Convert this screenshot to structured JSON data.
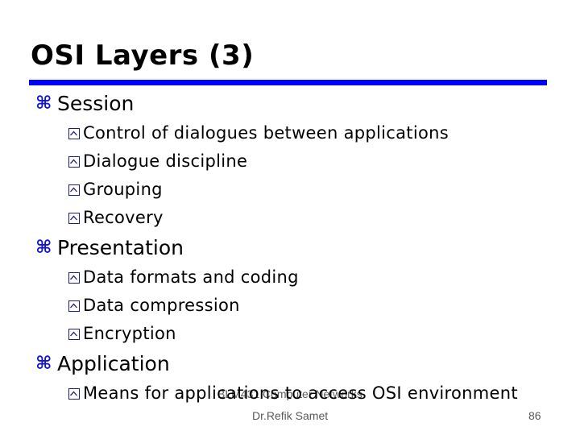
{
  "slide": {
    "title": "OSI Layers (3)",
    "accent_color": "#0000ff",
    "bullet_icon_l1": "command-key-icon",
    "bullet_icon_l2": "boxed-chevron-icon",
    "bullet_l1_glyph": "⌘",
    "sections": [
      {
        "heading": "Session",
        "items": [
          "Control of dialogues between applications",
          "Dialogue discipline",
          "Grouping",
          "Recovery"
        ]
      },
      {
        "heading": "Presentation",
        "items": [
          "Data formats and coding",
          "Data compression",
          "Encryption"
        ]
      },
      {
        "heading": "Application",
        "items": [
          "Means for applications to access OSI environment"
        ]
      }
    ]
  },
  "footer": {
    "course": "BLM431 Computer Networks",
    "author": "Dr.Refik Samet",
    "page_number": "86"
  }
}
